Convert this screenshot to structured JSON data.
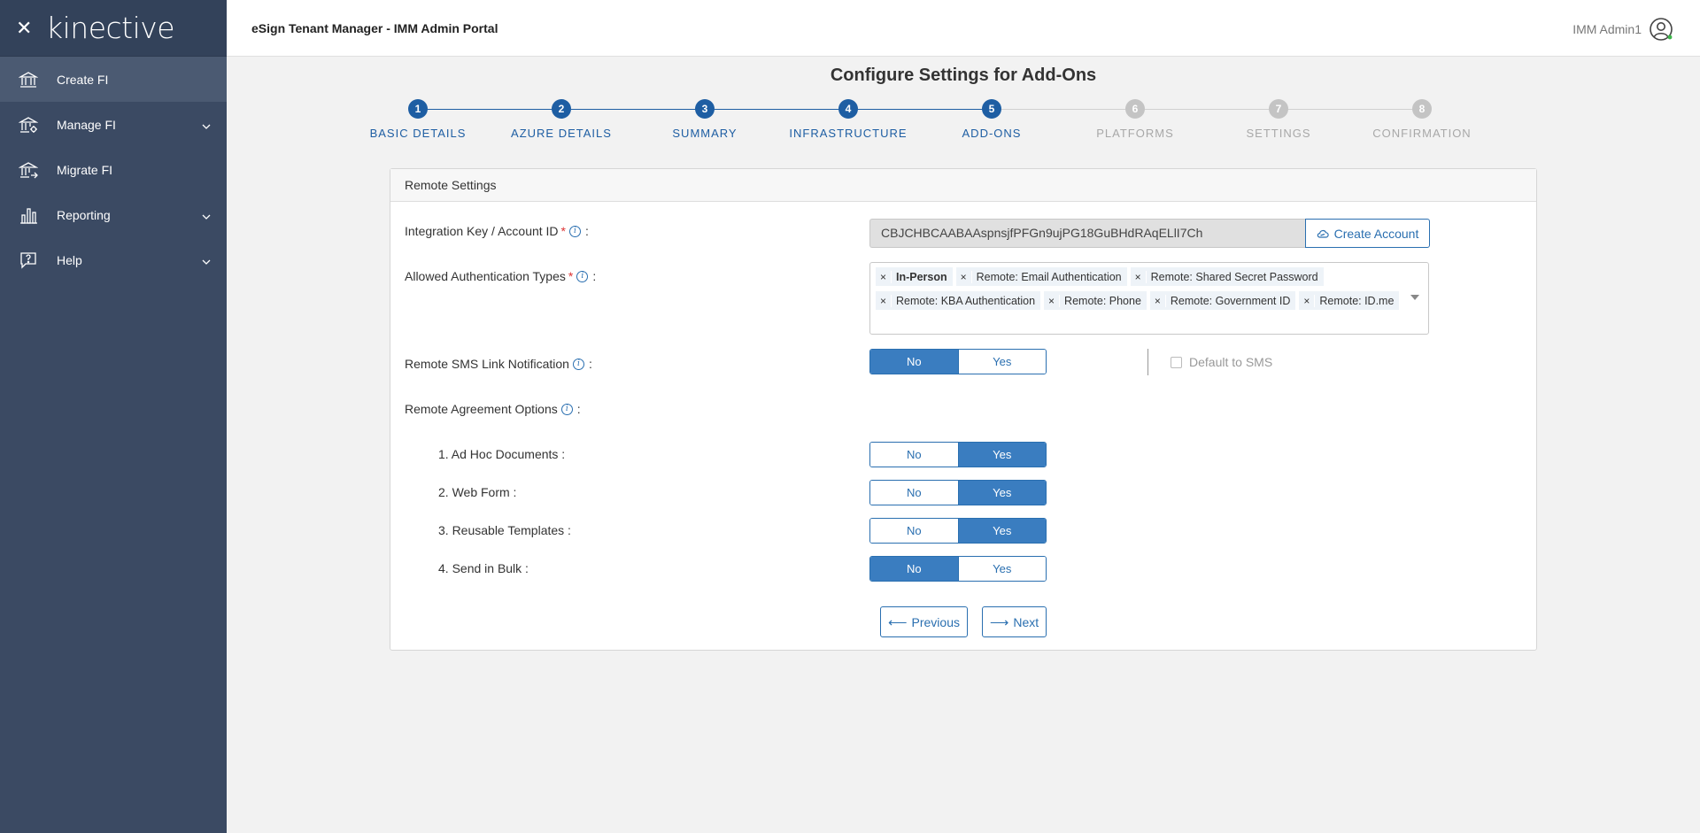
{
  "app": {
    "brand": "kinective",
    "title": "eSign Tenant Manager - IMM Admin Portal",
    "user": "IMM Admin1"
  },
  "sidebar": {
    "items": [
      {
        "label": "Create FI",
        "icon": "bank-icon",
        "active": true,
        "expandable": false
      },
      {
        "label": "Manage FI",
        "icon": "bank-settings-icon",
        "active": false,
        "expandable": true
      },
      {
        "label": "Migrate FI",
        "icon": "bank-transfer-icon",
        "active": false,
        "expandable": false
      },
      {
        "label": "Reporting",
        "icon": "bar-chart-icon",
        "active": false,
        "expandable": true
      },
      {
        "label": "Help",
        "icon": "help-bubble-icon",
        "active": false,
        "expandable": true
      }
    ]
  },
  "page": {
    "title": "Configure Settings for Add-Ons"
  },
  "stepper": {
    "steps": [
      {
        "num": "1",
        "label": "BASIC DETAILS",
        "state": "done"
      },
      {
        "num": "2",
        "label": "AZURE DETAILS",
        "state": "done"
      },
      {
        "num": "3",
        "label": "SUMMARY",
        "state": "done"
      },
      {
        "num": "4",
        "label": "INFRASTRUCTURE",
        "state": "done"
      },
      {
        "num": "5",
        "label": "ADD-ONS",
        "state": "current"
      },
      {
        "num": "6",
        "label": "PLATFORMS",
        "state": "pending"
      },
      {
        "num": "7",
        "label": "SETTINGS",
        "state": "pending"
      },
      {
        "num": "8",
        "label": "CONFIRMATION",
        "state": "pending"
      }
    ]
  },
  "colors": {
    "primary": "#2a6fb0",
    "primary_fill": "#3a7dc0",
    "step_active": "#1e5ea3",
    "step_pending": "#c4c4c4",
    "sidebar_bg": "#3b4a63"
  },
  "form": {
    "section_title": "Remote Settings",
    "integration_key": {
      "label": "Integration Key / Account ID",
      "colon": ":",
      "value": "CBJCHBCAABAAspnsjfPFGn9ujPG18GuBHdRAqELlI7Ch",
      "button": "Create Account"
    },
    "auth_types": {
      "label": "Allowed Authentication Types",
      "colon": ":",
      "selected": [
        "In-Person",
        "Remote: Email Authentication",
        "Remote: Shared Secret Password",
        "Remote: KBA Authentication",
        "Remote: Phone",
        "Remote: Government ID",
        "Remote: ID.me"
      ]
    },
    "sms": {
      "label": "Remote SMS Link Notification",
      "colon": ":",
      "value": "No",
      "default_label": "Default to SMS",
      "default_checked": false
    },
    "agreement": {
      "label": "Remote Agreement Options",
      "colon": ":",
      "options": [
        {
          "label": "1. Ad Hoc Documents :",
          "value": "Yes"
        },
        {
          "label": "2. Web Form :",
          "value": "Yes"
        },
        {
          "label": "3. Reusable Templates :",
          "value": "Yes"
        },
        {
          "label": "4. Send in Bulk :",
          "value": "No"
        }
      ]
    },
    "toggle_labels": {
      "no": "No",
      "yes": "Yes"
    },
    "buttons": {
      "previous": "Previous",
      "next": "Next"
    }
  }
}
